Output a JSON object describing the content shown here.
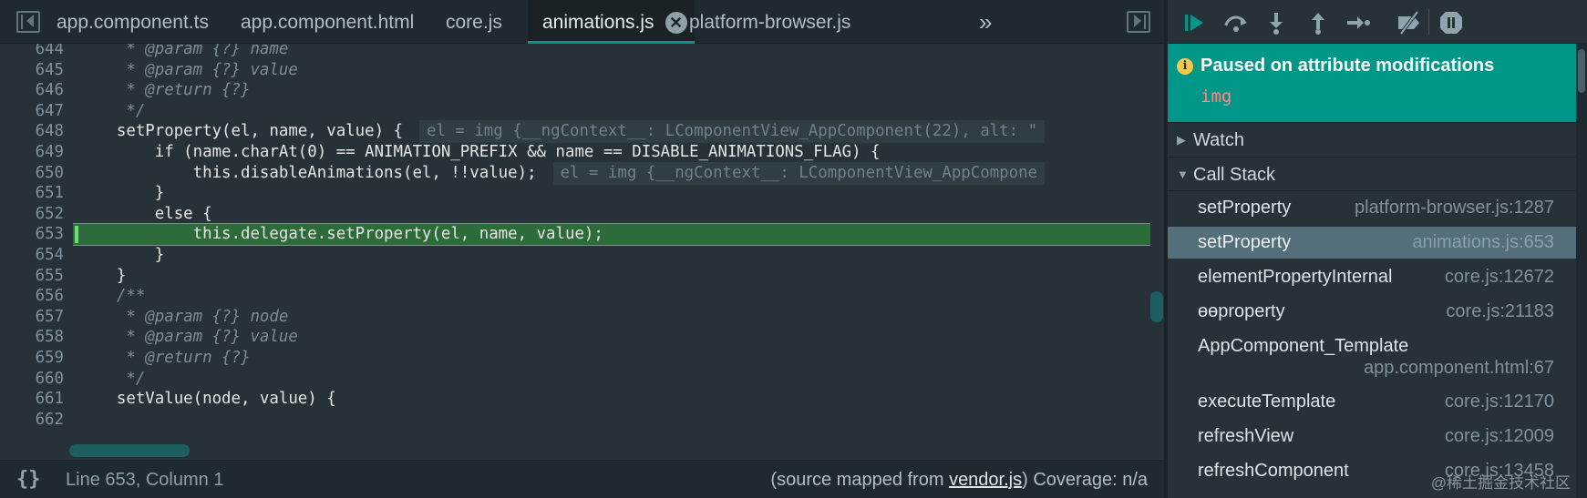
{
  "tabs": [
    {
      "label": "app.component.ts"
    },
    {
      "label": "app.component.html"
    },
    {
      "label": "core.js"
    },
    {
      "label": "animations.js",
      "active": true
    },
    {
      "label": "platform-browser.js"
    }
  ],
  "tab_close_glyph": "✕",
  "tab_overflow_glyph": "»",
  "code_lines": [
    {
      "num": "644",
      "text": "     * @param {?} name"
    },
    {
      "num": "645",
      "text": "     * @param {?} value"
    },
    {
      "num": "646",
      "text": "     * @return {?}"
    },
    {
      "num": "647",
      "text": "     */"
    },
    {
      "num": "648",
      "text": "    setProperty(el, name, value) {",
      "inline": "el = img {__ngContext__: LComponentView_AppComponent(22), alt: \""
    },
    {
      "num": "649",
      "text": "        if (name.charAt(0) == ANIMATION_PREFIX && name == DISABLE_ANIMATIONS_FLAG) {"
    },
    {
      "num": "650",
      "text": "            this.disableAnimations(el, !!value);",
      "inline": "el = img {__ngContext__: LComponentView_AppCompone"
    },
    {
      "num": "651",
      "text": "        }"
    },
    {
      "num": "652",
      "text": "        else {"
    },
    {
      "num": "653",
      "text": "            this.delegate.setProperty(el, name, value);",
      "highlight": true
    },
    {
      "num": "654",
      "text": "        }"
    },
    {
      "num": "655",
      "text": "    }"
    },
    {
      "num": "656",
      "text": "    /**"
    },
    {
      "num": "657",
      "text": "     * @param {?} node"
    },
    {
      "num": "658",
      "text": "     * @param {?} value"
    },
    {
      "num": "659",
      "text": "     * @return {?}"
    },
    {
      "num": "660",
      "text": "     */"
    },
    {
      "num": "661",
      "text": "    setValue(node, value) {"
    },
    {
      "num": "662",
      "text": ""
    }
  ],
  "status": {
    "format_glyph": "{}",
    "cursor": "Line 653, Column 1",
    "mapped_prefix": "(source mapped from ",
    "mapped_file": "vendor.js",
    "mapped_suffix": ")",
    "coverage": "Coverage: n/a"
  },
  "debugger": {
    "tool_icons": [
      "resume-icon",
      "step-over-icon",
      "step-into-icon",
      "step-out-icon",
      "step-icon",
      "deactivate-breakpoints-icon",
      "pause-on-exceptions-icon"
    ],
    "pause": {
      "info_glyph": "i",
      "title": "Paused on attribute modifications",
      "detail": "img"
    },
    "watch_label": "Watch",
    "callstack_label": "Call Stack",
    "frames": [
      {
        "fn": "setProperty",
        "loc": "platform-browser.js:1287"
      },
      {
        "fn": "setProperty",
        "loc": "animations.js:653",
        "selected": true
      },
      {
        "fn": "elementPropertyInternal",
        "loc": "core.js:12672"
      },
      {
        "fn": "ɵɵproperty",
        "loc": "core.js:21183"
      },
      {
        "fn": "AppComponent_Template",
        "loc": "app.component.html:67",
        "wrap": true
      },
      {
        "fn": "executeTemplate",
        "loc": "core.js:12170"
      },
      {
        "fn": "refreshView",
        "loc": "core.js:12009"
      },
      {
        "fn": "refreshComponent",
        "loc": "core.js:13458"
      }
    ],
    "watermark": "@稀土掘金技术社区"
  },
  "colors": {
    "accent": "#009688",
    "highlight_line": "#2e6b3a",
    "selected_frame": "#546e7a"
  }
}
